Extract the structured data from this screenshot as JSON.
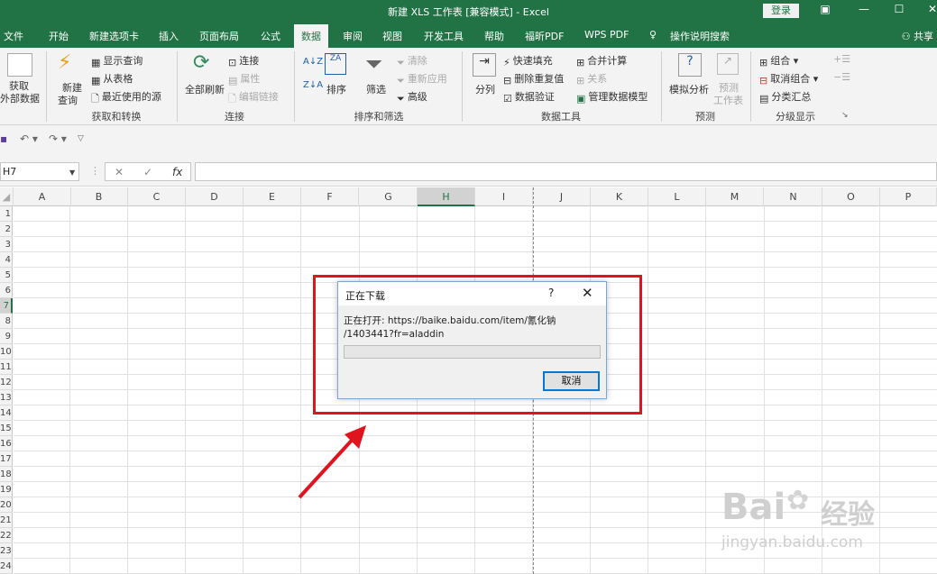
{
  "titlebar": {
    "title": "新建 XLS 工作表 [兼容模式] - Excel",
    "login": "登录"
  },
  "tabs": [
    {
      "label": "文件"
    },
    {
      "label": "开始"
    },
    {
      "label": "新建选项卡"
    },
    {
      "label": "插入"
    },
    {
      "label": "页面布局"
    },
    {
      "label": "公式"
    },
    {
      "label": "数据",
      "active": true
    },
    {
      "label": "审阅"
    },
    {
      "label": "视图"
    },
    {
      "label": "开发工具"
    },
    {
      "label": "帮助"
    },
    {
      "label": "福昕PDF"
    },
    {
      "label": "WPS PDF"
    },
    {
      "label": "操作说明搜索"
    }
  ],
  "share": "共享",
  "ribbon": {
    "get_external": {
      "line1": "获取",
      "line2": "外部数据"
    },
    "new_query": {
      "line1": "新建",
      "line2": "查询"
    },
    "show_query": "显示查询",
    "from_table": "从表格",
    "recent_sources": "最近使用的源",
    "group_get_transform": "获取和转换",
    "refresh_all": "全部刷新",
    "connections": "连接",
    "properties": "属性",
    "edit_links": "编辑链接",
    "group_connections": "连接",
    "sort": "排序",
    "filter": "筛选",
    "clear": "清除",
    "reapply": "重新应用",
    "advanced": "高级",
    "group_sort_filter": "排序和筛选",
    "text_to_columns": "分列",
    "flash_fill": "快速填充",
    "remove_duplicates": "删除重复值",
    "data_validation": "数据验证",
    "consolidate": "合并计算",
    "relationships": "关系",
    "manage_data_model": "管理数据模型",
    "group_data_tools": "数据工具",
    "what_if": "模拟分析",
    "forecast_sheet": {
      "line1": "预测",
      "line2": "工作表"
    },
    "group_forecast": "预测",
    "group_btn": "组合",
    "ungroup_btn": "取消组合",
    "subtotal": "分类汇总",
    "group_outline": "分级显示"
  },
  "formula_bar": {
    "name_box": "H7",
    "fx": "fx",
    "formula": ""
  },
  "grid": {
    "columns": [
      "A",
      "B",
      "C",
      "D",
      "E",
      "F",
      "G",
      "H",
      "I",
      "J",
      "K",
      "L",
      "M",
      "N",
      "O",
      "P"
    ],
    "rows": [
      "1",
      "2",
      "3",
      "4",
      "5",
      "6",
      "7",
      "8",
      "9",
      "10",
      "11",
      "12",
      "13",
      "14",
      "15",
      "16",
      "17",
      "18",
      "19",
      "20",
      "21",
      "22",
      "23",
      "24"
    ],
    "selected_column": "H",
    "selected_row": "7"
  },
  "dialog": {
    "title": "正在下载",
    "help": "?",
    "close": "✕",
    "message_line1": "正在打开: https://baike.baidu.com/item/氰化钠",
    "message_line2": "/1403441?fr=aladdin",
    "progress_fraction": 0,
    "cancel": "取消"
  },
  "watermark": {
    "brand": "Bai",
    "brand2": "经验",
    "url": "jingyan.baidu.com"
  },
  "colors": {
    "accent": "#217346",
    "annotation": "#e0141e"
  }
}
